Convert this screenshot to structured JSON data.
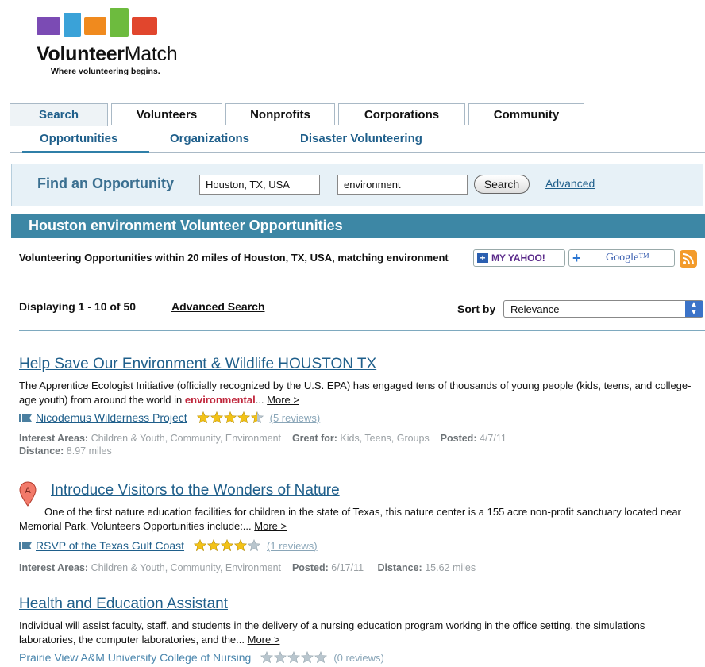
{
  "brand": {
    "name_bold": "Volunteer",
    "name_regular": "Match",
    "tagline": "Where volunteering begins.",
    "hand_colors": [
      "#7b4bb4",
      "#3aa2d8",
      "#f08a1e",
      "#6dbb3e",
      "#e1462d"
    ]
  },
  "tabs": [
    {
      "label": "Search",
      "active": true
    },
    {
      "label": "Volunteers",
      "active": false
    },
    {
      "label": "Nonprofits",
      "active": false
    },
    {
      "label": "Corporations",
      "active": false
    },
    {
      "label": "Community",
      "active": false
    }
  ],
  "subtabs": [
    {
      "label": "Opportunities",
      "active": true
    },
    {
      "label": "Organizations",
      "active": false
    },
    {
      "label": "Disaster Volunteering",
      "active": false
    }
  ],
  "search": {
    "label": "Find an Opportunity",
    "location_value": "Houston, TX, USA",
    "keyword_value": "environment",
    "button_label": "Search",
    "advanced_link": "Advanced"
  },
  "results_header": {
    "title": "Houston environment Volunteer Opportunities",
    "intro": "Volunteering Opportunities within 20 miles of Houston, TX, USA, matching environment"
  },
  "feeds": {
    "yahoo_label": "MY YAHOO!",
    "google_label": "Google™"
  },
  "listing": {
    "displaying": "Displaying 1 - 10 of 50",
    "advanced_search": "Advanced Search",
    "sort_label": "Sort by",
    "sort_value": "Relevance"
  },
  "results": [
    {
      "title": "Help Save Our Environment & Wildlife  HOUSTON TX",
      "desc_before": "The Apprentice Ecologist Initiative (officially recognized by the U.S. EPA) has engaged tens of thousands of young people (kids, teens, and college-age youth) from around the world in ",
      "desc_highlight": "environmental",
      "desc_after": "... ",
      "more": "More >",
      "org": "Nicodemus Wilderness Project",
      "rating": 4.5,
      "reviews": "(5 reviews)",
      "meta_interest_label": "Interest Areas:",
      "meta_interest": "Children & Youth, Community, Environment",
      "meta_great_label": "Great for:",
      "meta_great": "Kids, Teens, Groups",
      "meta_posted_label": "Posted:",
      "meta_posted": "4/7/11",
      "meta_distance_label": "Distance:",
      "meta_distance": "8.97 miles"
    },
    {
      "marker": "A",
      "title": "Introduce Visitors to the Wonders of Nature",
      "desc": "One of the first nature education facilities for children in the state of Texas, this nature center is a 155 acre non-profit sanctuary located near Memorial Park. Volunteers Opportunities include:... ",
      "more": "More >",
      "org": "RSVP of the Texas Gulf Coast",
      "rating": 4,
      "reviews": "(1 reviews)",
      "meta_interest_label": "Interest Areas:",
      "meta_interest": "Children & Youth, Community, Environment",
      "meta_posted_label": "Posted:",
      "meta_posted": "6/17/11",
      "meta_distance_label": "Distance:",
      "meta_distance": "15.62 miles"
    },
    {
      "title": "Health and Education Assistant",
      "desc": "Individual will assist faculty, staff, and students in the delivery of a nursing education program working in the office setting, the simulations laboratories, the computer laboratories, and the... ",
      "more": "More >",
      "org": "Prairie View A&M University College of Nursing",
      "rating": 0,
      "reviews": "(0 reviews)"
    }
  ],
  "colors": {
    "accent": "#3d87a5",
    "link": "#1f5f8b",
    "star_filled": "#f2c218",
    "star_empty": "#b9c6ce",
    "highlight": "#c0273c"
  }
}
